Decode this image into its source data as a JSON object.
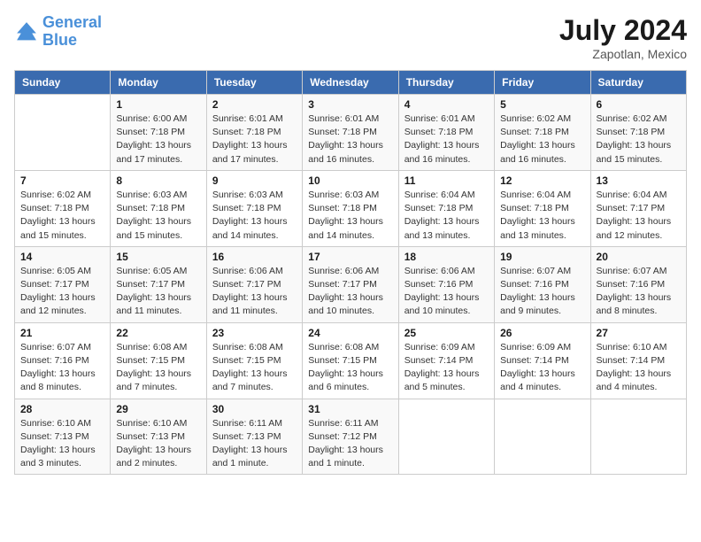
{
  "logo": {
    "line1": "General",
    "line2": "Blue"
  },
  "title": "July 2024",
  "location": "Zapotlan, Mexico",
  "days_of_week": [
    "Sunday",
    "Monday",
    "Tuesday",
    "Wednesday",
    "Thursday",
    "Friday",
    "Saturday"
  ],
  "weeks": [
    [
      {
        "num": "",
        "sunrise": "",
        "sunset": "",
        "daylight": ""
      },
      {
        "num": "1",
        "sunrise": "Sunrise: 6:00 AM",
        "sunset": "Sunset: 7:18 PM",
        "daylight": "Daylight: 13 hours and 17 minutes."
      },
      {
        "num": "2",
        "sunrise": "Sunrise: 6:01 AM",
        "sunset": "Sunset: 7:18 PM",
        "daylight": "Daylight: 13 hours and 17 minutes."
      },
      {
        "num": "3",
        "sunrise": "Sunrise: 6:01 AM",
        "sunset": "Sunset: 7:18 PM",
        "daylight": "Daylight: 13 hours and 16 minutes."
      },
      {
        "num": "4",
        "sunrise": "Sunrise: 6:01 AM",
        "sunset": "Sunset: 7:18 PM",
        "daylight": "Daylight: 13 hours and 16 minutes."
      },
      {
        "num": "5",
        "sunrise": "Sunrise: 6:02 AM",
        "sunset": "Sunset: 7:18 PM",
        "daylight": "Daylight: 13 hours and 16 minutes."
      },
      {
        "num": "6",
        "sunrise": "Sunrise: 6:02 AM",
        "sunset": "Sunset: 7:18 PM",
        "daylight": "Daylight: 13 hours and 15 minutes."
      }
    ],
    [
      {
        "num": "7",
        "sunrise": "Sunrise: 6:02 AM",
        "sunset": "Sunset: 7:18 PM",
        "daylight": "Daylight: 13 hours and 15 minutes."
      },
      {
        "num": "8",
        "sunrise": "Sunrise: 6:03 AM",
        "sunset": "Sunset: 7:18 PM",
        "daylight": "Daylight: 13 hours and 15 minutes."
      },
      {
        "num": "9",
        "sunrise": "Sunrise: 6:03 AM",
        "sunset": "Sunset: 7:18 PM",
        "daylight": "Daylight: 13 hours and 14 minutes."
      },
      {
        "num": "10",
        "sunrise": "Sunrise: 6:03 AM",
        "sunset": "Sunset: 7:18 PM",
        "daylight": "Daylight: 13 hours and 14 minutes."
      },
      {
        "num": "11",
        "sunrise": "Sunrise: 6:04 AM",
        "sunset": "Sunset: 7:18 PM",
        "daylight": "Daylight: 13 hours and 13 minutes."
      },
      {
        "num": "12",
        "sunrise": "Sunrise: 6:04 AM",
        "sunset": "Sunset: 7:18 PM",
        "daylight": "Daylight: 13 hours and 13 minutes."
      },
      {
        "num": "13",
        "sunrise": "Sunrise: 6:04 AM",
        "sunset": "Sunset: 7:17 PM",
        "daylight": "Daylight: 13 hours and 12 minutes."
      }
    ],
    [
      {
        "num": "14",
        "sunrise": "Sunrise: 6:05 AM",
        "sunset": "Sunset: 7:17 PM",
        "daylight": "Daylight: 13 hours and 12 minutes."
      },
      {
        "num": "15",
        "sunrise": "Sunrise: 6:05 AM",
        "sunset": "Sunset: 7:17 PM",
        "daylight": "Daylight: 13 hours and 11 minutes."
      },
      {
        "num": "16",
        "sunrise": "Sunrise: 6:06 AM",
        "sunset": "Sunset: 7:17 PM",
        "daylight": "Daylight: 13 hours and 11 minutes."
      },
      {
        "num": "17",
        "sunrise": "Sunrise: 6:06 AM",
        "sunset": "Sunset: 7:17 PM",
        "daylight": "Daylight: 13 hours and 10 minutes."
      },
      {
        "num": "18",
        "sunrise": "Sunrise: 6:06 AM",
        "sunset": "Sunset: 7:16 PM",
        "daylight": "Daylight: 13 hours and 10 minutes."
      },
      {
        "num": "19",
        "sunrise": "Sunrise: 6:07 AM",
        "sunset": "Sunset: 7:16 PM",
        "daylight": "Daylight: 13 hours and 9 minutes."
      },
      {
        "num": "20",
        "sunrise": "Sunrise: 6:07 AM",
        "sunset": "Sunset: 7:16 PM",
        "daylight": "Daylight: 13 hours and 8 minutes."
      }
    ],
    [
      {
        "num": "21",
        "sunrise": "Sunrise: 6:07 AM",
        "sunset": "Sunset: 7:16 PM",
        "daylight": "Daylight: 13 hours and 8 minutes."
      },
      {
        "num": "22",
        "sunrise": "Sunrise: 6:08 AM",
        "sunset": "Sunset: 7:15 PM",
        "daylight": "Daylight: 13 hours and 7 minutes."
      },
      {
        "num": "23",
        "sunrise": "Sunrise: 6:08 AM",
        "sunset": "Sunset: 7:15 PM",
        "daylight": "Daylight: 13 hours and 7 minutes."
      },
      {
        "num": "24",
        "sunrise": "Sunrise: 6:08 AM",
        "sunset": "Sunset: 7:15 PM",
        "daylight": "Daylight: 13 hours and 6 minutes."
      },
      {
        "num": "25",
        "sunrise": "Sunrise: 6:09 AM",
        "sunset": "Sunset: 7:14 PM",
        "daylight": "Daylight: 13 hours and 5 minutes."
      },
      {
        "num": "26",
        "sunrise": "Sunrise: 6:09 AM",
        "sunset": "Sunset: 7:14 PM",
        "daylight": "Daylight: 13 hours and 4 minutes."
      },
      {
        "num": "27",
        "sunrise": "Sunrise: 6:10 AM",
        "sunset": "Sunset: 7:14 PM",
        "daylight": "Daylight: 13 hours and 4 minutes."
      }
    ],
    [
      {
        "num": "28",
        "sunrise": "Sunrise: 6:10 AM",
        "sunset": "Sunset: 7:13 PM",
        "daylight": "Daylight: 13 hours and 3 minutes."
      },
      {
        "num": "29",
        "sunrise": "Sunrise: 6:10 AM",
        "sunset": "Sunset: 7:13 PM",
        "daylight": "Daylight: 13 hours and 2 minutes."
      },
      {
        "num": "30",
        "sunrise": "Sunrise: 6:11 AM",
        "sunset": "Sunset: 7:13 PM",
        "daylight": "Daylight: 13 hours and 1 minute."
      },
      {
        "num": "31",
        "sunrise": "Sunrise: 6:11 AM",
        "sunset": "Sunset: 7:12 PM",
        "daylight": "Daylight: 13 hours and 1 minute."
      },
      {
        "num": "",
        "sunrise": "",
        "sunset": "",
        "daylight": ""
      },
      {
        "num": "",
        "sunrise": "",
        "sunset": "",
        "daylight": ""
      },
      {
        "num": "",
        "sunrise": "",
        "sunset": "",
        "daylight": ""
      }
    ]
  ]
}
